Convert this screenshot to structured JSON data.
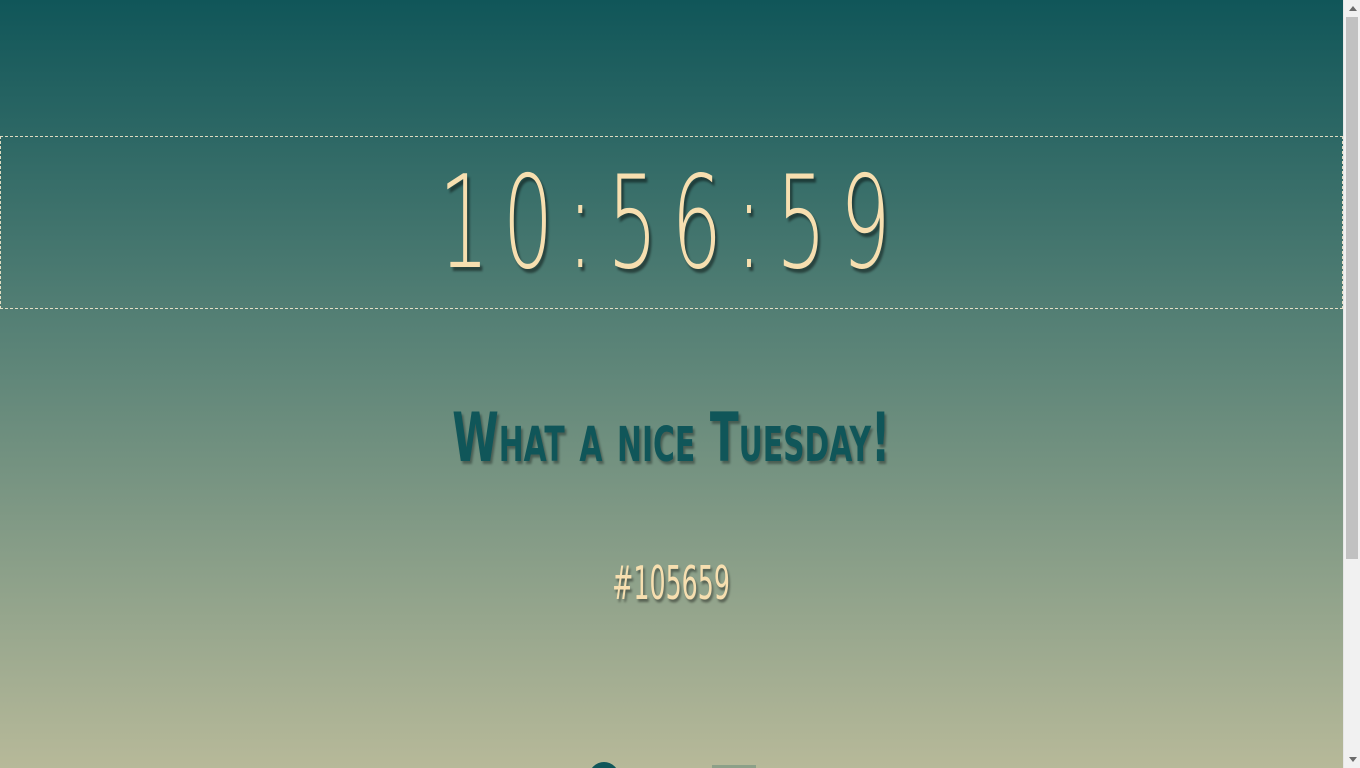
{
  "clock": {
    "time": "10:56:59"
  },
  "greeting": {
    "text": "What a nice Tuesday!"
  },
  "hex_color": {
    "text": "#105659"
  },
  "colors": {
    "accent": "#105659",
    "text_light": "#f7dfb0",
    "gradient_bottom": "#b7b999"
  },
  "scrollbar": {
    "up_icon": "chevron-up-icon",
    "down_icon": "chevron-down-icon"
  }
}
